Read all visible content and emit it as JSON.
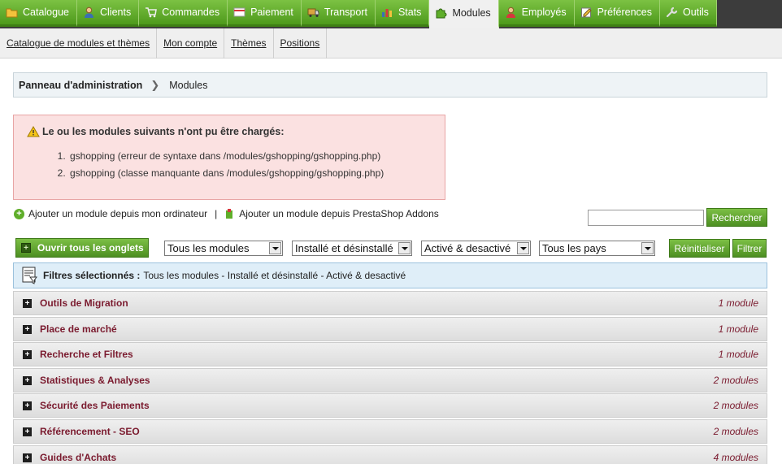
{
  "nav": {
    "tabs": [
      {
        "label": "Catalogue",
        "icon": "folder-icon"
      },
      {
        "label": "Clients",
        "icon": "user-icon"
      },
      {
        "label": "Commandes",
        "icon": "cart-icon"
      },
      {
        "label": "Paiement",
        "icon": "payment-icon"
      },
      {
        "label": "Transport",
        "icon": "truck-icon"
      },
      {
        "label": "Stats",
        "icon": "chart-icon"
      },
      {
        "label": "Modules",
        "icon": "puzzle-icon"
      },
      {
        "label": "Employés",
        "icon": "employee-icon"
      },
      {
        "label": "Préférences",
        "icon": "preferences-icon"
      },
      {
        "label": "Outils",
        "icon": "tools-icon"
      }
    ],
    "active": "Modules"
  },
  "subnav": [
    "Catalogue de modules et thèmes",
    "Mon compte",
    "Thèmes",
    "Positions"
  ],
  "breadcrumb": {
    "home": "Panneau d'administration",
    "current": "Modules"
  },
  "error": {
    "title": "Le ou les modules suivants n'ont pu être chargés:",
    "items": [
      "gshopping (erreur de syntaxe dans /modules/gshopping/gshopping.php)",
      "gshopping (classe manquante dans /modules/gshopping/gshopping.php)"
    ]
  },
  "add": {
    "from_computer": "Ajouter un module depuis mon ordinateur",
    "separator": "|",
    "from_addons": "Ajouter un module depuis PrestaShop Addons"
  },
  "search": {
    "value": "",
    "button": "Rechercher"
  },
  "filters": {
    "open_all": "Ouvrir tous les onglets",
    "modules": "Tous les modules",
    "install": "Installé et désinstallé",
    "status": "Activé & desactivé",
    "country": "Tous les pays",
    "reset": "Réinitialiser",
    "filter": "Filtrer"
  },
  "selected": {
    "label": "Filtres sélectionnés :",
    "value": "Tous les modules - Installé et désinstallé - Activé & desactivé"
  },
  "categories": [
    {
      "name": "Outils de Migration",
      "count": "1 module"
    },
    {
      "name": "Place de marché",
      "count": "1 module"
    },
    {
      "name": "Recherche et Filtres",
      "count": "1 module"
    },
    {
      "name": "Statistiques & Analyses",
      "count": "2 modules"
    },
    {
      "name": "Sécurité des Paiements",
      "count": "2 modules"
    },
    {
      "name": "Référencement - SEO",
      "count": "2 modules"
    },
    {
      "name": "Guides d'Achats",
      "count": "4 modules"
    }
  ]
}
